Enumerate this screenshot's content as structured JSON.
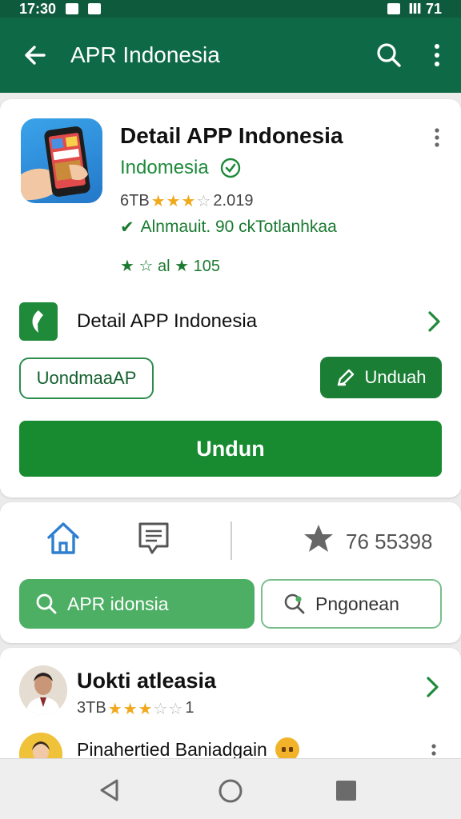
{
  "status_bar": {
    "time": "17:30",
    "right_text": "Ⅲ 71"
  },
  "app_bar": {
    "title": "APR Indonesia"
  },
  "app_card": {
    "title": "Detail APP Indonesia",
    "developer": "Indomesia",
    "rating_prefix": "6TB",
    "rating_suffix": "2.019",
    "feature_text": "Alnmauit.  90 ckTotlanhkaa",
    "small_rating": "★ ☆ al ★ 105",
    "row_label": "Detail APP Indonesia",
    "outline_button_label": "UondmaaAP",
    "unduh_button_label": "Unduah",
    "big_button_label": "Undun"
  },
  "nav_card": {
    "count": "76 55398",
    "search_button_label": "APR idonsia",
    "second_button_label": "Pngonean"
  },
  "reviews": [
    {
      "name": "Uokti atleasia",
      "rating_text": "3TB",
      "rating_count": "1"
    },
    {
      "name": "Pinahertied Baniadgain"
    }
  ],
  "colors": {
    "primary": "#0e6a46",
    "button_green": "#188a30",
    "star": "#f1a91c"
  }
}
